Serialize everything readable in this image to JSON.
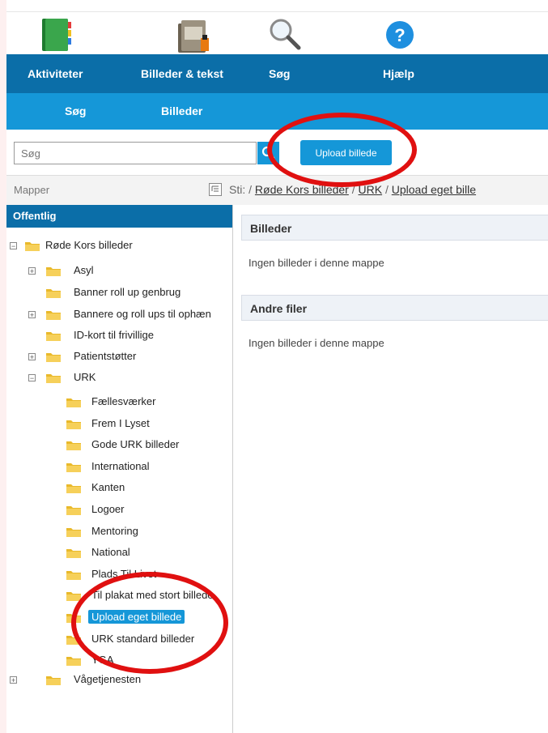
{
  "nav": {
    "items": [
      {
        "label": "Aktiviteter",
        "icon": "book-icon"
      },
      {
        "label": "Billeder & tekst",
        "icon": "folder-icon"
      },
      {
        "label": "Søg",
        "icon": "magnifier-icon"
      },
      {
        "label": "Hjælp",
        "icon": "help-icon"
      }
    ]
  },
  "subnav": {
    "items": [
      "Søg",
      "Billeder"
    ]
  },
  "search": {
    "placeholder": "Søg",
    "upload_label": "Upload billede"
  },
  "path": {
    "mapper_label": "Mapper",
    "prefix": "Sti: /",
    "crumbs": [
      "Røde Kors billeder",
      "URK",
      "Upload eget bille"
    ],
    "sep": "/"
  },
  "tree": {
    "header": "Offentlig",
    "root": "Røde Kors billeder",
    "level1": [
      "Asyl",
      "Banner roll up genbrug",
      "Bannere og roll ups til ophæn",
      "ID-kort til frivillige",
      "Patientstøtter",
      "URK"
    ],
    "urk_children": [
      "Fællesværker",
      "Frem I Lyset",
      "Gode URK billeder",
      "International",
      "Kanten",
      "Logoer",
      "Mentoring",
      "National",
      "Plads Til Livet",
      "Til plakat med stort billede",
      "Upload eget billede",
      "URK standard billeder",
      "YGA"
    ],
    "last": "Vågetjenesten",
    "selected": "Upload eget billede"
  },
  "content": {
    "images_title": "Billeder",
    "images_empty": "Ingen billeder i denne mappe",
    "files_title": "Andre filer",
    "files_empty": "Ingen billeder i denne mappe"
  },
  "colors": {
    "dark_blue": "#0b6ea8",
    "light_blue": "#1597d8",
    "annotation_red": "#e01010"
  }
}
